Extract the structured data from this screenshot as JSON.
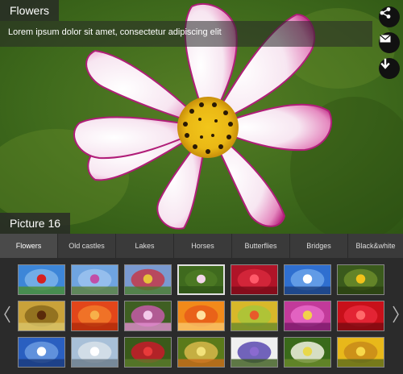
{
  "gallery": {
    "album_title": "Flowers",
    "caption": "Lorem ipsum dolor sit amet, consectetur adipiscing elit",
    "picture_label": "Picture 16"
  },
  "actions": {
    "share_icon": "share-icon",
    "email_icon": "email-icon",
    "download_icon": "download-icon"
  },
  "tabs": [
    {
      "label": "Flowers"
    },
    {
      "label": "Old castles"
    },
    {
      "label": "Lakes"
    },
    {
      "label": "Horses"
    },
    {
      "label": "Butterflies"
    },
    {
      "label": "Bridges"
    },
    {
      "label": "Black&white"
    }
  ],
  "active_tab": "Flowers",
  "thumbnails": [
    {
      "subject": "red-poppy-field",
      "colors": [
        "#3d86d8",
        "#7bb3ea",
        "#4a8f2e"
      ],
      "accent": "#d62020"
    },
    {
      "subject": "purple-lupine",
      "colors": [
        "#6fa4e0",
        "#9cc3ee",
        "#5b7f3a"
      ],
      "accent": "#c24ea6"
    },
    {
      "subject": "tulip-field",
      "colors": [
        "#7a9ad0",
        "#c33a4a",
        "#4a7c2a"
      ],
      "accent": "#e7c33a"
    },
    {
      "subject": "pink-cosmos",
      "colors": [
        "#3f6a1e",
        "#4e7a24",
        "#2f5516"
      ],
      "accent": "#f3d6ea"
    },
    {
      "subject": "red-rose",
      "colors": [
        "#b01428",
        "#d8283c",
        "#7a0a18"
      ],
      "accent": "#ff5a6a"
    },
    {
      "subject": "mount-fuji",
      "colors": [
        "#2f6fd0",
        "#6aa3ea",
        "#1c3f7a"
      ],
      "accent": "#ffffff"
    },
    {
      "subject": "sunflower",
      "colors": [
        "#3a5a1c",
        "#6b8c2a",
        "#2a4012"
      ],
      "accent": "#f2c21a"
    },
    {
      "subject": "butterflies-on-flowers",
      "colors": [
        "#c9a23a",
        "#8a6a1c",
        "#d8c46a"
      ],
      "accent": "#5a2a0a"
    },
    {
      "subject": "orange-gerbera",
      "colors": [
        "#e2461a",
        "#f27a2a",
        "#b02a0a"
      ],
      "accent": "#f7b04a"
    },
    {
      "subject": "pink-rhododendron",
      "colors": [
        "#3f5f22",
        "#c65aa8",
        "#e28ed0"
      ],
      "accent": "#f3c8ea"
    },
    {
      "subject": "orange-lily",
      "colors": [
        "#f28a1a",
        "#e85a1a",
        "#f7c46a"
      ],
      "accent": "#ffe2a0"
    },
    {
      "subject": "flower-meadow",
      "colors": [
        "#d8b82a",
        "#a8c43a",
        "#6a8a2a"
      ],
      "accent": "#e85a2a"
    },
    {
      "subject": "pink-aster",
      "colors": [
        "#c23a9a",
        "#e86ac8",
        "#7a1a6a"
      ],
      "accent": "#f2d24a"
    },
    {
      "subject": "red-rose-closeup",
      "colors": [
        "#c8101a",
        "#e8283a",
        "#7a0a10"
      ],
      "accent": "#ff6a6a"
    },
    {
      "subject": "fuji-snow",
      "colors": [
        "#2a5fc0",
        "#6a9ae0",
        "#1a3a7a"
      ],
      "accent": "#ffffff"
    },
    {
      "subject": "white-blossoms",
      "colors": [
        "#a8c0d8",
        "#d8e2ea",
        "#6a7a8a"
      ],
      "accent": "#ffffff"
    },
    {
      "subject": "red-lily",
      "colors": [
        "#3a5a1a",
        "#c81a2a",
        "#5a7a2a"
      ],
      "accent": "#e83a3a"
    },
    {
      "subject": "spiky-flower",
      "colors": [
        "#5a7a1a",
        "#d8b84a",
        "#c86a1a"
      ],
      "accent": "#f2e27a"
    },
    {
      "subject": "passion-flower",
      "colors": [
        "#f0f0f0",
        "#5a4ab0",
        "#3a5a1a"
      ],
      "accent": "#8a6ad0"
    },
    {
      "subject": "white-lily",
      "colors": [
        "#3a6a1a",
        "#f2f2e2",
        "#6a8a2a"
      ],
      "accent": "#e8d84a"
    },
    {
      "subject": "sunflower-field",
      "colors": [
        "#e8b81a",
        "#c88a1a",
        "#5a6a1a"
      ],
      "accent": "#f7d84a"
    }
  ],
  "selected_thumbnail_index": 3,
  "nav": {
    "prev_icon": "chevron-left-icon",
    "next_icon": "chevron-right-icon"
  }
}
